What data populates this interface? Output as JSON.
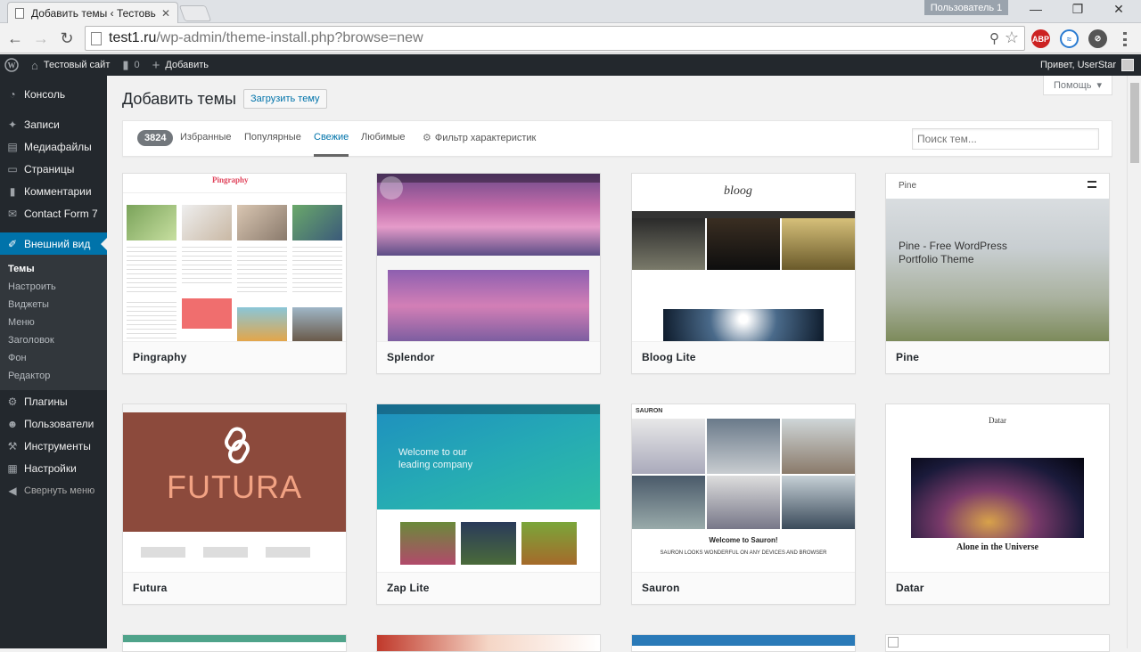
{
  "browser": {
    "tab_title": "Добавить темы ‹ Тестовы",
    "tab_close": "✕",
    "user_badge": "Пользователь 1",
    "url_host": "test1.ru",
    "url_path": "/wp-admin/theme-install.php?browse=new",
    "ext_abp": "ABP"
  },
  "adminbar": {
    "site_name": "Тестовый сайт",
    "comments_count": "0",
    "add_new": "Добавить",
    "greeting": "Привет, UserStar"
  },
  "sidebar": {
    "items": [
      {
        "label": "Консоль",
        "icon": "dashboard-icon"
      },
      {
        "label": "Записи",
        "icon": "pin-icon"
      },
      {
        "label": "Медиафайлы",
        "icon": "media-icon"
      },
      {
        "label": "Страницы",
        "icon": "page-icon"
      },
      {
        "label": "Комментарии",
        "icon": "comment-icon"
      },
      {
        "label": "Contact Form 7",
        "icon": "mail-icon"
      },
      {
        "label": "Внешний вид",
        "icon": "brush-icon"
      },
      {
        "label": "Плагины",
        "icon": "plugin-icon"
      },
      {
        "label": "Пользователи",
        "icon": "users-icon"
      },
      {
        "label": "Инструменты",
        "icon": "wrench-icon"
      },
      {
        "label": "Настройки",
        "icon": "settings-icon"
      }
    ],
    "submenu": [
      "Темы",
      "Настроить",
      "Виджеты",
      "Меню",
      "Заголовок",
      "Фон",
      "Редактор"
    ],
    "collapse": "Свернуть меню"
  },
  "page": {
    "help": "Помощь",
    "title": "Добавить темы",
    "upload": "Загрузить тему",
    "count": "3824",
    "tabs": [
      "Избранные",
      "Популярные",
      "Свежие",
      "Любимые"
    ],
    "feature_filter": "Фильтр характеристик",
    "search_placeholder": "Поиск тем..."
  },
  "themes": [
    {
      "name": "Pingraphy"
    },
    {
      "name": "Splendor"
    },
    {
      "name": "Bloog Lite"
    },
    {
      "name": "Pine"
    },
    {
      "name": "Futura"
    },
    {
      "name": "Zap Lite"
    },
    {
      "name": "Sauron"
    },
    {
      "name": "Datar"
    }
  ],
  "previews": {
    "pingraphy_logo": "Pingraphy",
    "bloog_logo": "bloog",
    "pine_brand": "Pine",
    "pine_headline_1": "Pine - Free WordPress",
    "pine_headline_2": "Portfolio Theme",
    "futura_word": "FUTURA",
    "zap_welcome_1": "Welcome to our",
    "zap_welcome_2": "leading company",
    "sauron_logo": "SAURON",
    "sauron_welcome": "Welcome to Sauron!",
    "sauron_tagline": "SAURON LOOKS WONDERFUL ON ANY DEVICES AND BROWSER",
    "datar_logo": "Datar",
    "datar_caption": "Alone in the Universe"
  }
}
